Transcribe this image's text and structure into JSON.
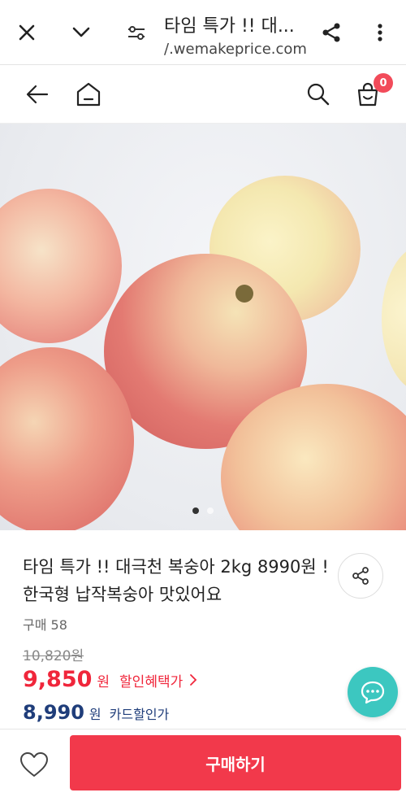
{
  "browser": {
    "title": "타임 특가 !! 대...",
    "url": "/.wemakeprice.com",
    "icons": [
      "close-icon",
      "chevron-down-icon",
      "site-settings-icon",
      "share-icon",
      "more-vert-icon"
    ]
  },
  "header": {
    "cart_count": "0",
    "icons": [
      "back-arrow-icon",
      "home-icon",
      "search-icon",
      "cart-icon"
    ]
  },
  "product": {
    "title": "타임 특가 !! 대극천 복숭아 2kg 8990원 ! 한국형 납작복숭아 맛있어요",
    "purchase_count": "구매 58",
    "original_price": "10,820원",
    "sale_price": "9,850",
    "sale_unit": "원",
    "sale_label": "할인혜택가",
    "card_price": "8,990",
    "card_unit": "원",
    "card_label": "카드할인가",
    "image_dots": {
      "total": 2,
      "active": 1
    }
  },
  "actions": {
    "buy_label": "구매하기",
    "icons": [
      "heart-icon",
      "chat-icon"
    ]
  },
  "colors": {
    "accent_red": "#f0263b",
    "card_blue": "#1f3d7a",
    "chat_teal": "#3cc7c0",
    "buy_button": "#f2394b"
  }
}
